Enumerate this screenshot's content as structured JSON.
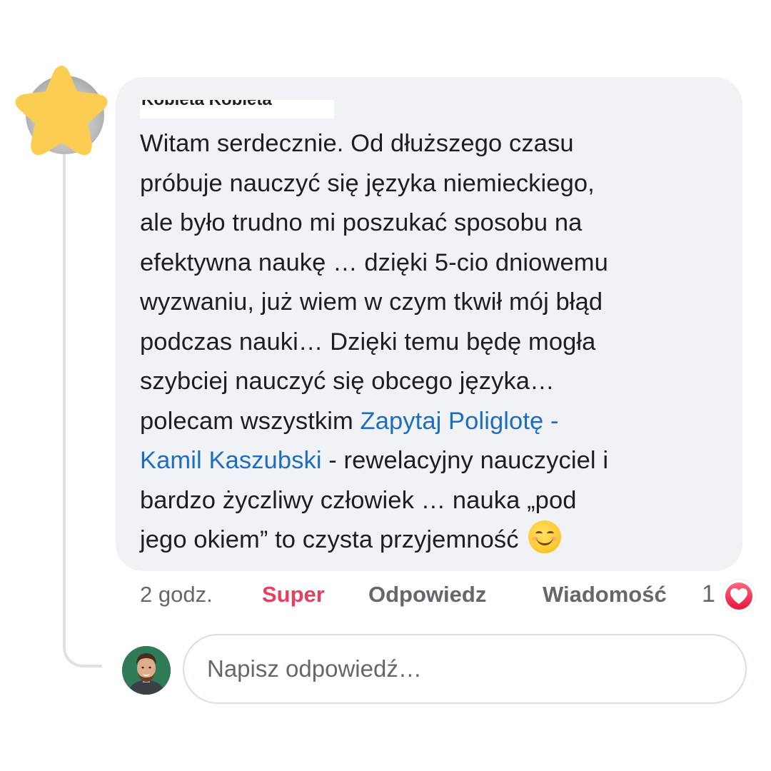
{
  "comment": {
    "author_name": "Kobieta Kobieta",
    "text_lines": [
      "Witam serdecznie. Od dłuższego czasu",
      "próbuje nauczyć się języka niemieckiego,",
      "ale było trudno mi poszukać sposobu na",
      "efektywna naukę …  dzięki 5-cio dniowemu",
      "wyzwaniu, już wiem w czym tkwił mój błąd",
      "podczas nauki… Dzięki temu będę mogła",
      "szybciej nauczyć się  obcego języka…",
      "polecam wszystkim "
    ],
    "mention_part1": "Zapytaj Poliglotę -",
    "mention_part2": "Kamil Kaszubski",
    "after_mention": " - rewelacyjny nauczyciel i",
    "line_bardzo": "bardzo życzliwy człowiek … nauka „pod",
    "last_line": "jego okiem” to czysta przyjemność",
    "emoji": "smiling-face-emoji",
    "link_color": "#1b6ec2",
    "bubble_color": "#f0f2f5"
  },
  "actions": {
    "time": "2 godz.",
    "reaction_label": "Super",
    "reaction_color": "#e4405f",
    "reply_label": "Odpowiedz",
    "message_label": "Wiadomość",
    "reaction_count": "1",
    "reaction_icon": "heart-icon"
  },
  "reply_box": {
    "placeholder": "Napisz odpowiedź…"
  },
  "icons": {
    "commenter_avatar_overlay": "star-icon",
    "user_avatar": "user-avatar"
  }
}
